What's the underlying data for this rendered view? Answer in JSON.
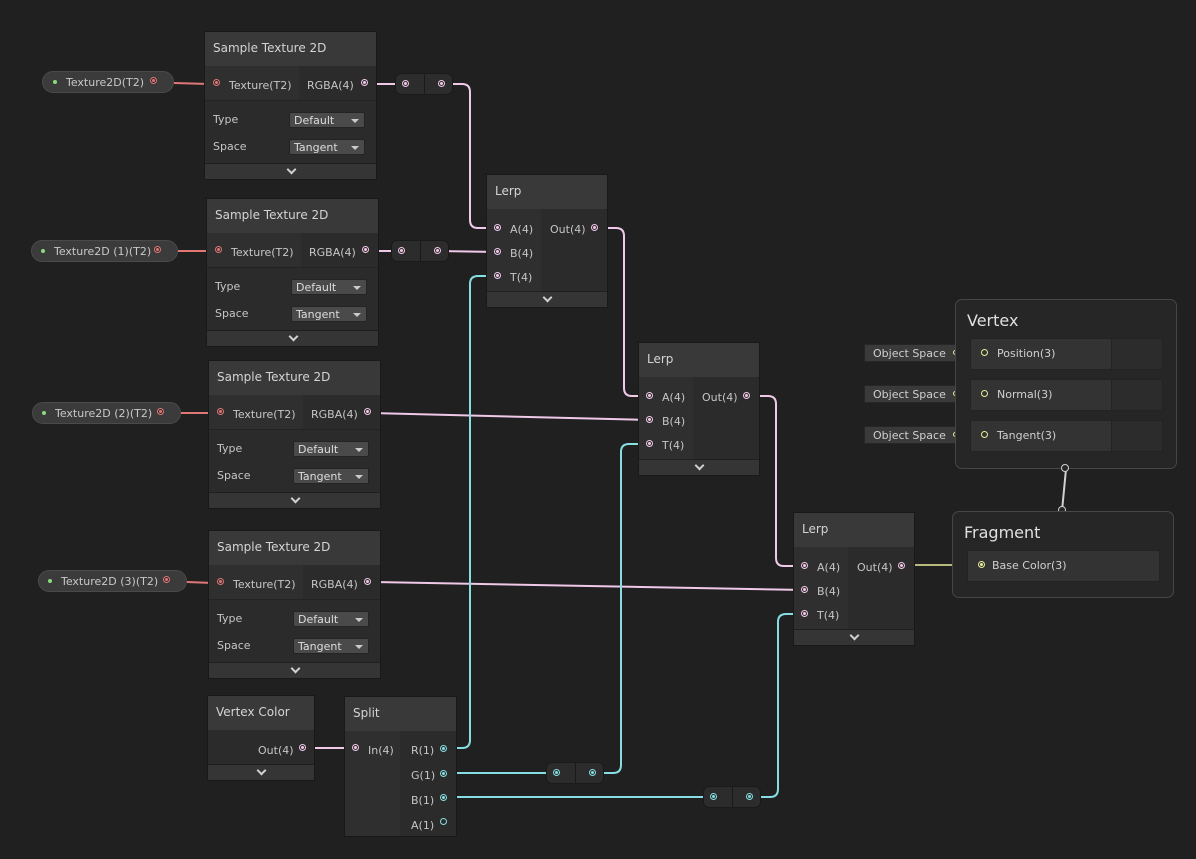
{
  "colors": {
    "background": "#202020",
    "texture_wire": "#e07777",
    "vector4_wire": "#f0c8e8",
    "float_wire": "#87dee2",
    "vector3_wire": "#e9ee9a",
    "property_dot": "#8bdb7e"
  },
  "properties": [
    {
      "label": "Texture2D(T2)"
    },
    {
      "label": "Texture2D (1)(T2)"
    },
    {
      "label": "Texture2D (2)(T2)"
    },
    {
      "label": "Texture2D (3)(T2)"
    }
  ],
  "sample_nodes": [
    {
      "title": "Sample Texture 2D",
      "input": "Texture(T2)",
      "output": "RGBA(4)",
      "type_label": "Type",
      "type_value": "Default",
      "space_label": "Space",
      "space_value": "Tangent"
    },
    {
      "title": "Sample Texture 2D",
      "input": "Texture(T2)",
      "output": "RGBA(4)",
      "type_label": "Type",
      "type_value": "Default",
      "space_label": "Space",
      "space_value": "Tangent"
    },
    {
      "title": "Sample Texture 2D",
      "input": "Texture(T2)",
      "output": "RGBA(4)",
      "type_label": "Type",
      "type_value": "Default",
      "space_label": "Space",
      "space_value": "Tangent"
    },
    {
      "title": "Sample Texture 2D",
      "input": "Texture(T2)",
      "output": "RGBA(4)",
      "type_label": "Type",
      "type_value": "Default",
      "space_label": "Space",
      "space_value": "Tangent"
    }
  ],
  "lerp_nodes": [
    {
      "title": "Lerp",
      "inputs": [
        "A(4)",
        "B(4)",
        "T(4)"
      ],
      "output": "Out(4)"
    },
    {
      "title": "Lerp",
      "inputs": [
        "A(4)",
        "B(4)",
        "T(4)"
      ],
      "output": "Out(4)"
    },
    {
      "title": "Lerp",
      "inputs": [
        "A(4)",
        "B(4)",
        "T(4)"
      ],
      "output": "Out(4)"
    }
  ],
  "vertex_color": {
    "title": "Vertex Color",
    "output": "Out(4)"
  },
  "split": {
    "title": "Split",
    "input": "In(4)",
    "outputs": [
      "R(1)",
      "G(1)",
      "B(1)",
      "A(1)"
    ]
  },
  "vertex_context": {
    "title": "Vertex",
    "blocks": [
      {
        "label": "Position(3)",
        "space": "Object Space"
      },
      {
        "label": "Normal(3)",
        "space": "Object Space"
      },
      {
        "label": "Tangent(3)",
        "space": "Object Space"
      }
    ]
  },
  "fragment_context": {
    "title": "Fragment",
    "blocks": [
      {
        "label": "Base Color(3)"
      }
    ]
  }
}
